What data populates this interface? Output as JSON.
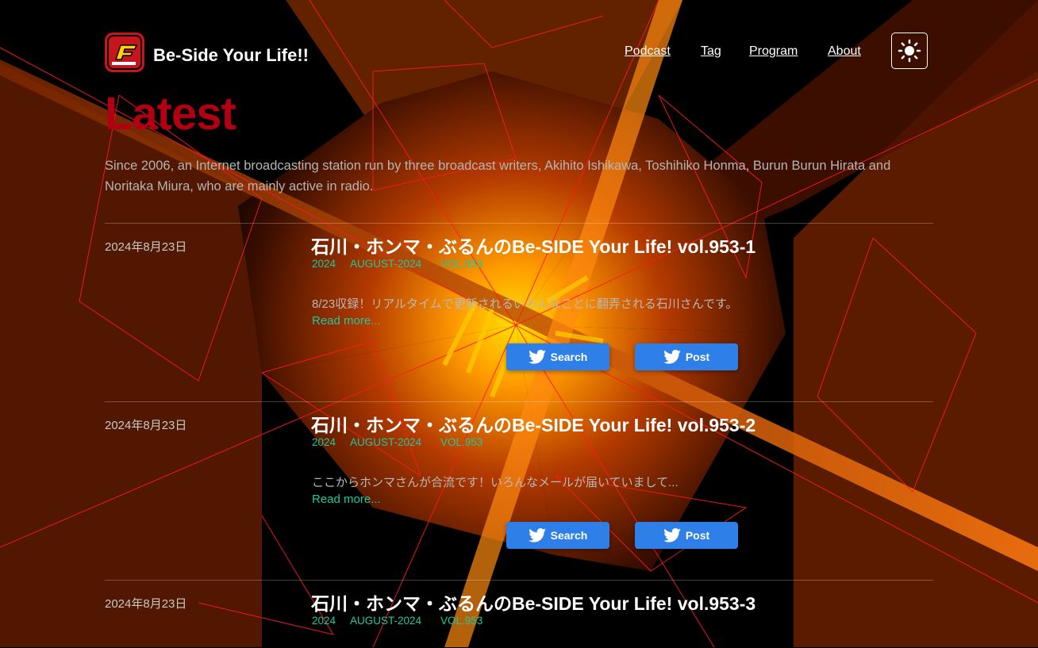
{
  "site": {
    "title": "Be-Side Your Life!!",
    "logo_icon": "be-side-logo-icon"
  },
  "nav": {
    "items": [
      {
        "label": "Podcast"
      },
      {
        "label": "Tag"
      },
      {
        "label": "Program"
      },
      {
        "label": "About"
      }
    ],
    "theme_toggle_icon": "sun-icon"
  },
  "page": {
    "heading": "Latest",
    "description": "Since 2006, an Internet broadcasting station run by three broadcast writers, Akihito Ishikawa, Toshihiko Honma, Burun Burun Hirata and Noritaka Miura, who are mainly active in radio."
  },
  "posts": [
    {
      "date": "2024年8月23日",
      "title": "石川・ホンマ・ぶるんのBe-SIDE Your Life! vol.953-1",
      "tags": [
        "2024",
        "AUGUST-2024",
        "VOL.953"
      ],
      "excerpt": "8/23収録！リアルタイムで更新されるいろんなことに翻弄される石川さんです。",
      "read_more": "Read more...",
      "search_label": "Search",
      "post_label": "Post"
    },
    {
      "date": "2024年8月23日",
      "title": "石川・ホンマ・ぶるんのBe-SIDE Your Life! vol.953-2",
      "tags": [
        "2024",
        "AUGUST-2024",
        "VOL.953"
      ],
      "excerpt": "ここからホンマさんが合流です！いろんなメールが届いていまして...",
      "read_more": "Read more...",
      "search_label": "Search",
      "post_label": "Post"
    },
    {
      "date": "2024年8月23日",
      "title": "石川・ホンマ・ぶるんのBe-SIDE Your Life! vol.953-3",
      "tags": [
        "2024",
        "AUGUST-2024",
        "VOL.953"
      ]
    }
  ],
  "colors": {
    "accent_title": "#b00012",
    "tag": "#1fc9a0",
    "twitter_button": "#2f7fe8",
    "background": "#000000"
  }
}
